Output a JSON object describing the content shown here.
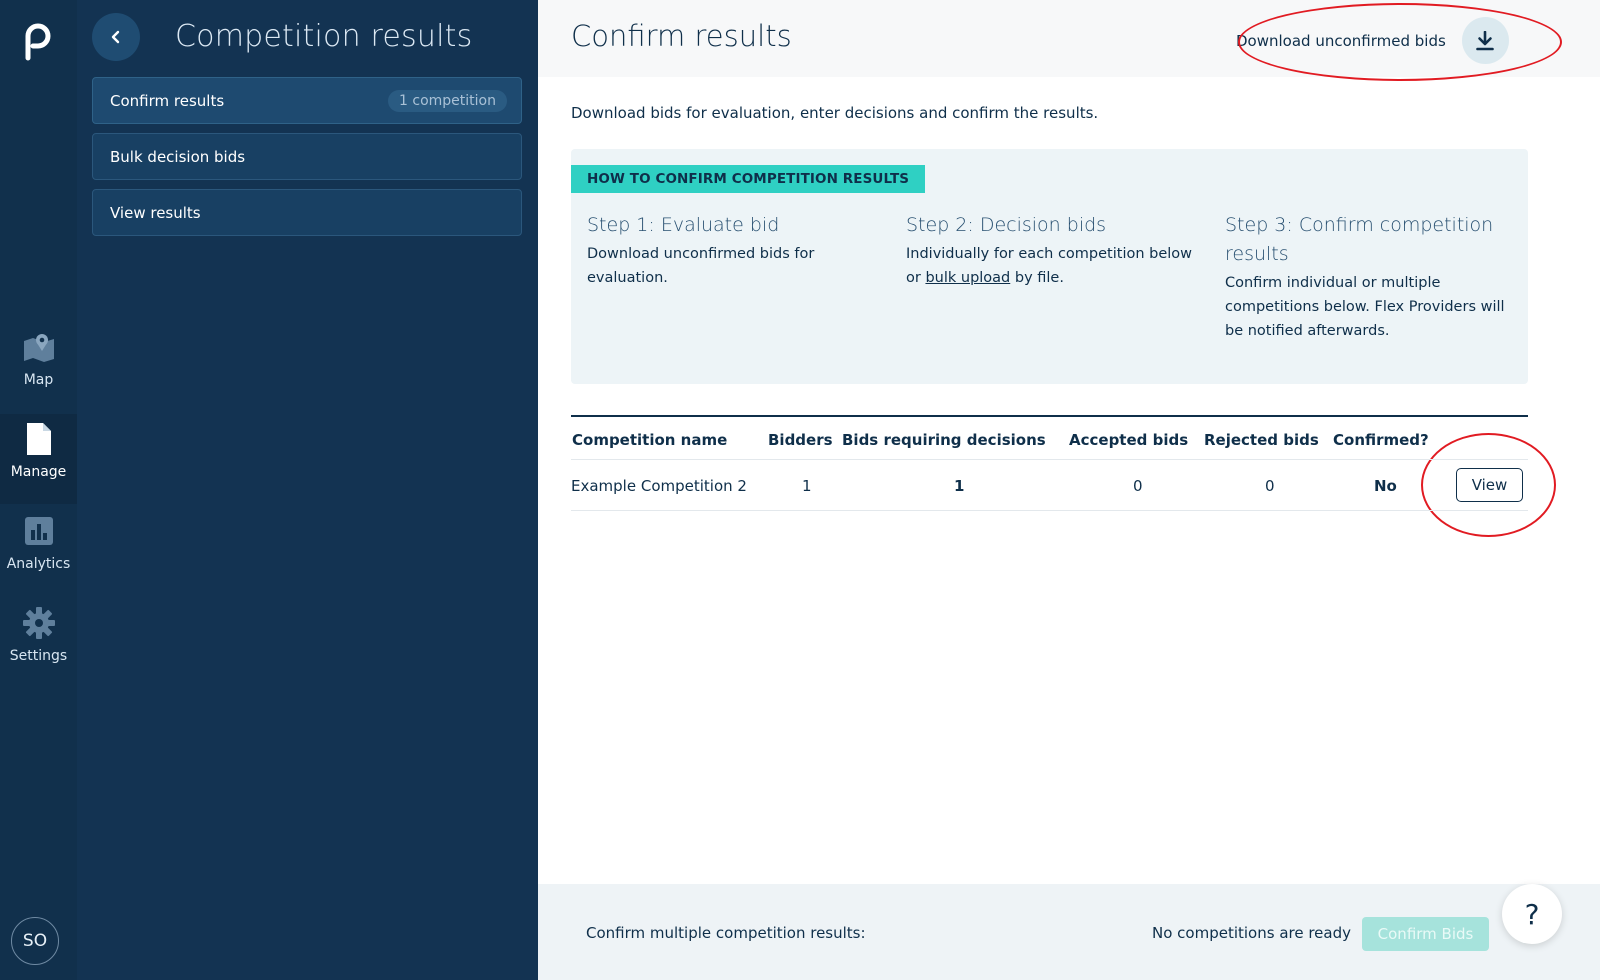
{
  "rail": {
    "items": [
      {
        "label": "Map",
        "icon": "map-icon"
      },
      {
        "label": "Manage",
        "icon": "document-icon"
      },
      {
        "label": "Analytics",
        "icon": "bar-chart-icon"
      },
      {
        "label": "Settings",
        "icon": "gear-icon"
      }
    ],
    "avatar": "SO"
  },
  "sidebar": {
    "title": "Competition results",
    "items": [
      {
        "label": "Confirm results",
        "badge": "1 competition"
      },
      {
        "label": "Bulk decision bids"
      },
      {
        "label": "View results"
      }
    ]
  },
  "main": {
    "title": "Confirm results",
    "download_label": "Download unconfirmed bids",
    "subtitle": "Download bids for evaluation, enter decisions and confirm the results.",
    "howto": {
      "badge": "HOW TO CONFIRM COMPETITION RESULTS",
      "steps": [
        {
          "title": "Step 1: Evaluate bid",
          "body": "Download unconfirmed bids for evaluation."
        },
        {
          "title": "Step 2: Decision bids",
          "body_pre": "Individually for each competition below or ",
          "body_link": "bulk upload",
          "body_post": " by file."
        },
        {
          "title": "Step 3: Confirm competition results",
          "body": "Confirm individual or multiple competitions below. Flex Providers will be notified afterwards."
        }
      ]
    },
    "table": {
      "columns": [
        "Competition name",
        "Bidders",
        "Bids requiring decisions",
        "Accepted bids",
        "Rejected bids",
        "Confirmed?"
      ],
      "rows": [
        {
          "name": "Example Competition 2",
          "bidders": "1",
          "requiring": "1",
          "accepted": "0",
          "rejected": "0",
          "confirmed": "No",
          "action": "View"
        }
      ]
    },
    "bottom": {
      "label": "Confirm multiple competition results:",
      "status": "No competitions are ready",
      "confirm_label": "Confirm Bids"
    },
    "help": "?"
  },
  "colors": {
    "rail_bg": "#11304c",
    "sidebar_bg": "#133352",
    "accent_teal": "#2fd0c3",
    "annotation_red": "#e11b22"
  }
}
